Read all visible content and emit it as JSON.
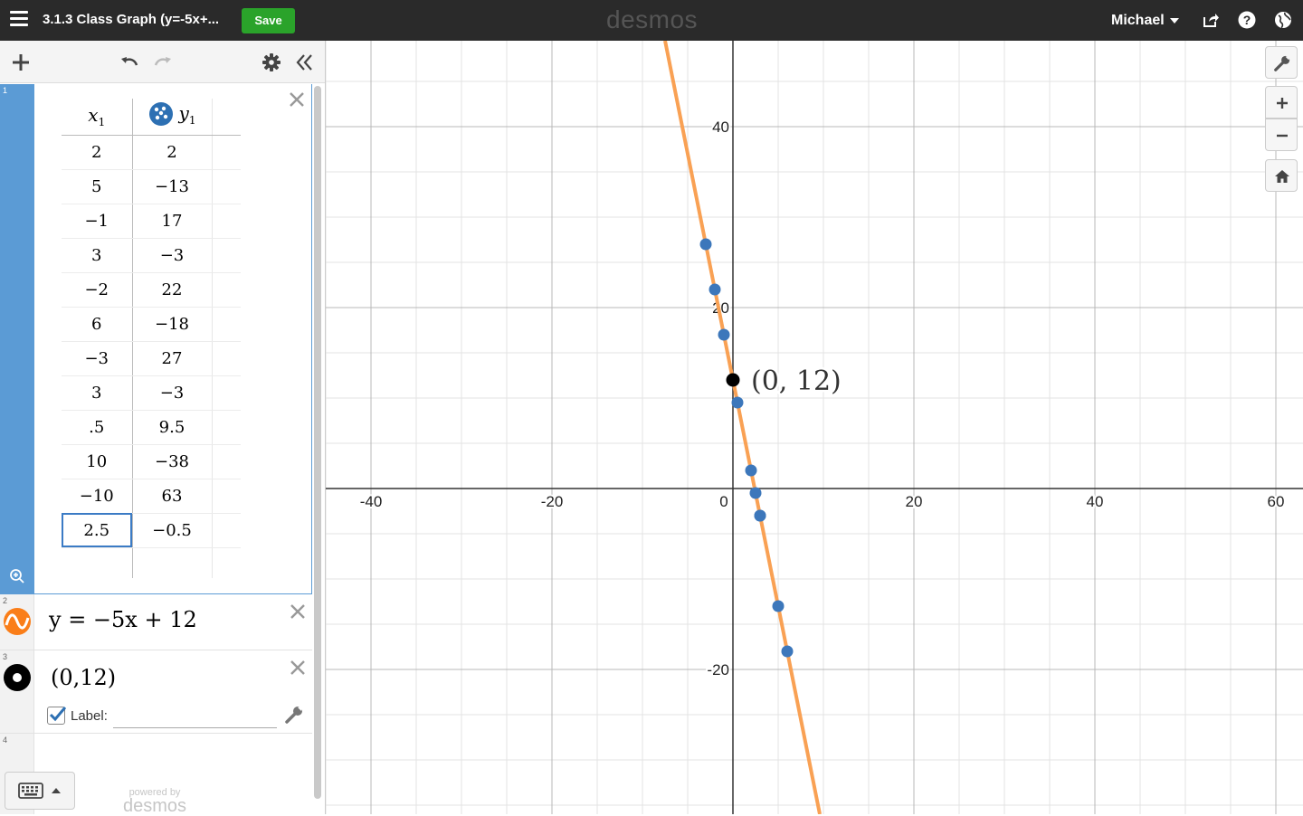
{
  "header": {
    "title": "3.1.3 Class Graph (y=-5x+...",
    "save_label": "Save",
    "brand": "desmos",
    "user_name": "Michael"
  },
  "expressions": [
    {
      "index": "1",
      "type": "table",
      "columns": {
        "x": "x",
        "x_sub": "1",
        "y": "y",
        "y_sub": "1"
      },
      "rows": [
        [
          "2",
          "2"
        ],
        [
          "5",
          "−13"
        ],
        [
          "−1",
          "17"
        ],
        [
          "3",
          "−3"
        ],
        [
          "−2",
          "22"
        ],
        [
          "6",
          "−18"
        ],
        [
          "−3",
          "27"
        ],
        [
          "3",
          "−3"
        ],
        [
          ".5",
          "9.5"
        ],
        [
          "10",
          "−38"
        ],
        [
          "−10",
          "63"
        ],
        [
          "2.5",
          "−0.5"
        ]
      ],
      "color": "#2d70b3"
    },
    {
      "index": "2",
      "type": "expression",
      "latex_text": "y = −5x + 12",
      "color": "#fa7e19"
    },
    {
      "index": "3",
      "type": "point",
      "latex_text": "(0,12)",
      "label_text": "Label:",
      "label_checked": true,
      "label_value": "",
      "color": "#000000"
    },
    {
      "index": "4",
      "type": "empty"
    }
  ],
  "footer": {
    "powered_by": "powered by",
    "brand": "desmos"
  },
  "graph": {
    "x_range": [
      -45,
      63
    ],
    "y_range": [
      -36,
      49.5
    ],
    "major_step": 20,
    "minor_step": 5,
    "x_tick_labels": [
      "-40",
      "-20",
      "0",
      "20",
      "40",
      "60"
    ],
    "y_tick_labels": [
      "40",
      "20",
      "-20"
    ],
    "line": {
      "slope": -5,
      "intercept": 12,
      "color": "#f9a154"
    },
    "table_points_color": "#3c77bb",
    "point": {
      "x": 0,
      "y": 12,
      "label": "(0, 12)",
      "color": "#000000"
    }
  },
  "colors": {
    "topbar": "#2a2a2a",
    "save_green": "#2aa32a",
    "selected_gutter": "#5b9bd5"
  }
}
